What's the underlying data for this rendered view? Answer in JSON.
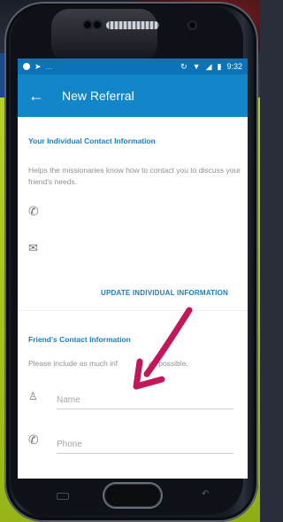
{
  "status_bar": {
    "time": "9:32",
    "left_icons": [
      "notification-icon",
      "messenger-icon",
      "signal-bars-icon"
    ],
    "right_icons": [
      "sync-icon",
      "wifi-icon",
      "cellular-icon",
      "battery-icon"
    ]
  },
  "app_bar": {
    "back_icon": "arrow-left-icon",
    "title": "New Referral"
  },
  "individual_section": {
    "heading": "Your Individual Contact Information",
    "help_text": "Helps the missionaries know how to contact you to discuss your friend's needs.",
    "phone_icon": "phone-icon",
    "email_icon": "email-icon",
    "update_link": "UPDATE INDIVIDUAL INFORMATION"
  },
  "friend_section": {
    "heading": "Friend's Contact Information",
    "help_text_before": "Please include as much inf",
    "help_text_after": "as possible.",
    "name_field": {
      "icon": "person-icon",
      "placeholder": "Name",
      "value": ""
    },
    "phone_field": {
      "icon": "phone-icon",
      "placeholder": "Phone",
      "value": ""
    }
  },
  "annotation": {
    "arrow_color": "#c2185b",
    "arrow_icon": "pointing-arrow-icon"
  },
  "colors": {
    "primary": "#1286c9",
    "status_bar": "#0d73b8",
    "accent_text": "#1c7fc0",
    "muted_text": "#8e9196",
    "background_lime": "#a6c21f"
  }
}
